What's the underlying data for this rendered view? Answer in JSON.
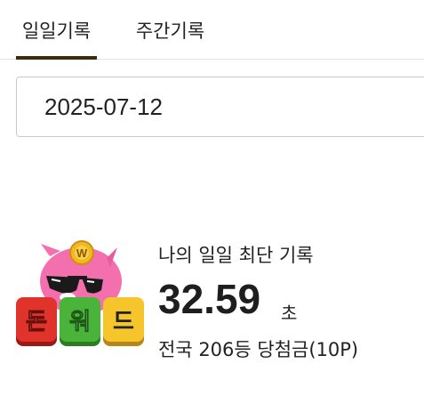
{
  "tabs": {
    "daily": "일일기록",
    "weekly": "주간기록"
  },
  "date_field": {
    "value": "2025-07-12"
  },
  "logo": {
    "coin_letter": "W",
    "tiles": [
      "돈",
      "워",
      "드"
    ]
  },
  "record": {
    "title": "나의 일일 최단 기록",
    "time": "32.59",
    "unit": "초",
    "rank": "전국 206등 당첨금(10P)"
  },
  "colors": {
    "tab_underline": "#3a2c0b",
    "pig_pink": "#f36fae",
    "coin_gold": "#f2b722",
    "tile_red": "#e0332b",
    "tile_green": "#49b33a",
    "tile_yellow": "#f6c52c"
  }
}
